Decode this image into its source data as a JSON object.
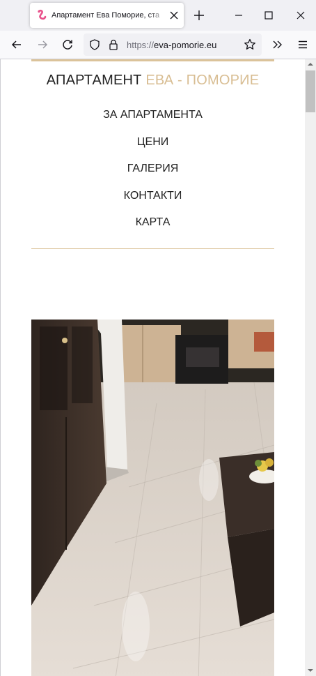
{
  "browser": {
    "tab_title": "Апартамент Ева Поморие, ста",
    "url_scheme": "https://",
    "url_host": "eva-pomorie.eu"
  },
  "site": {
    "title_main": "АПАРТАМЕНТ ",
    "title_accent": "ЕВА - ПОМОРИЕ",
    "accent_color": "#d8bd92",
    "menu": [
      {
        "label": "ЗА АПАРТАМЕНТА"
      },
      {
        "label": "ЦЕНИ"
      },
      {
        "label": "ГАЛЕРИЯ"
      },
      {
        "label": "КОНТАКТИ"
      },
      {
        "label": "КАРТА"
      }
    ]
  },
  "icons": {
    "favicon": "flamingo-icon",
    "close": "close-icon",
    "new_tab": "plus-icon",
    "back": "back-arrow-icon",
    "forward": "forward-arrow-icon",
    "reload": "reload-icon",
    "tracking": "shield-icon",
    "lock": "lock-icon",
    "bookmark": "star-icon",
    "overflow": "chevrons-right-icon",
    "menu": "hamburger-icon"
  }
}
